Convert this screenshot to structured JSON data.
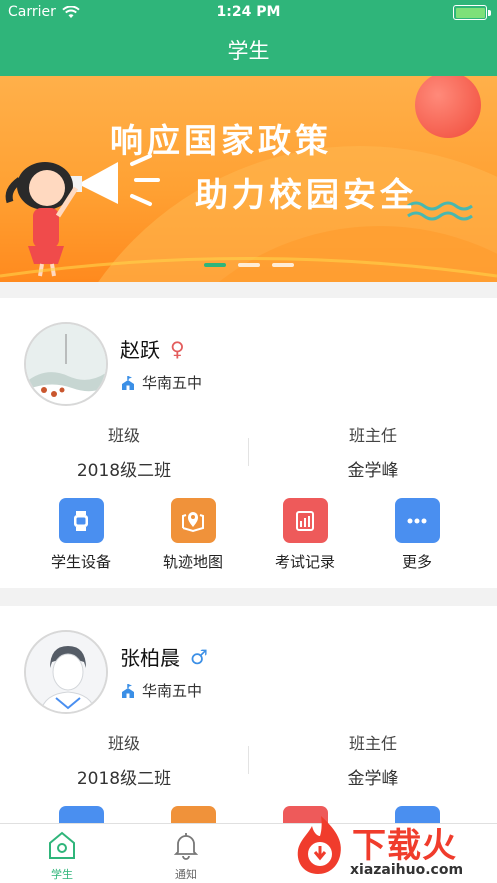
{
  "status_bar": {
    "carrier": "Carrier",
    "time": "1:24 PM"
  },
  "nav": {
    "title": "学生"
  },
  "banner": {
    "line1": "响应国家政策",
    "line2": "助力校园安全",
    "slide_index": 1,
    "slide_count": 3
  },
  "students": [
    {
      "name": "赵跃",
      "gender_symbol": "♀",
      "school": "华南五中",
      "class_label": "班级",
      "class_value": "2018级二班",
      "teacher_label": "班主任",
      "teacher_value": "金学峰",
      "actions": [
        {
          "label": "学生设备",
          "icon": "watch-icon",
          "color": "#4a8ff0"
        },
        {
          "label": "轨迹地图",
          "icon": "map-pin-icon",
          "color": "#f0923a"
        },
        {
          "label": "考试记录",
          "icon": "chart-icon",
          "color": "#ee5a5a"
        },
        {
          "label": "更多",
          "icon": "more-icon",
          "color": "#4a8ff0"
        }
      ]
    },
    {
      "name": "张柏晨",
      "gender_symbol": "♂",
      "school": "华南五中",
      "class_label": "班级",
      "class_value": "2018级二班",
      "teacher_label": "班主任",
      "teacher_value": "金学峰"
    }
  ],
  "tabs": [
    {
      "label": "学生",
      "icon": "home-icon",
      "active": true
    },
    {
      "label": "通知",
      "icon": "bell-icon",
      "active": false
    }
  ],
  "watermark": {
    "brand": "下载火",
    "url": "xiazaihuo.com"
  },
  "colors": {
    "primary": "#2fb57a",
    "banner": "#ffa133"
  }
}
